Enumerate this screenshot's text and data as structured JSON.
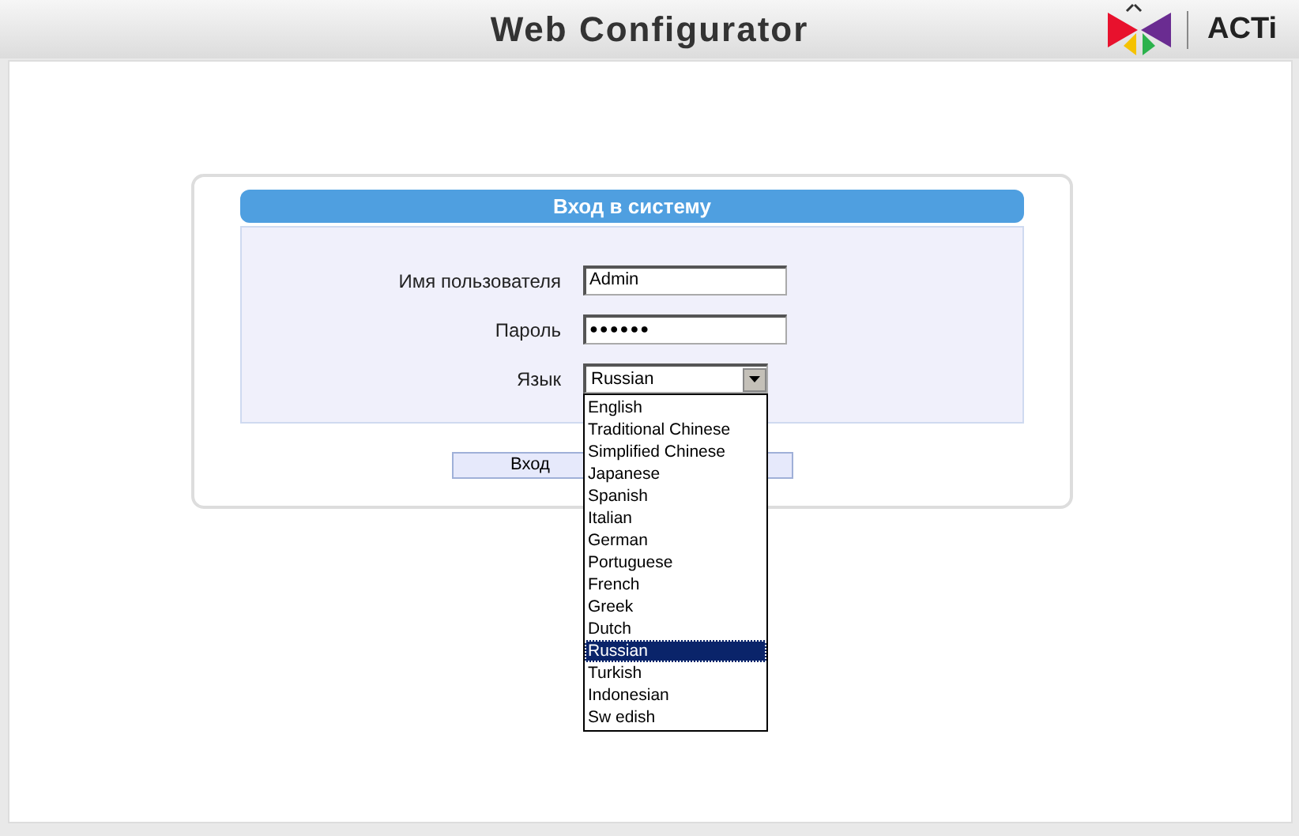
{
  "header": {
    "title": "Web Configurator",
    "logo_text": "ACTi"
  },
  "login": {
    "title": "Вход в систему",
    "fields": [
      {
        "kind": "text",
        "label": "Имя пользователя",
        "value": "Admin"
      },
      {
        "kind": "password",
        "label": "Пароль",
        "value": "●●●●●●"
      },
      {
        "kind": "select",
        "label": "Язык",
        "value": "Russian",
        "expanded": true
      }
    ],
    "button": "Вход"
  },
  "language_options": [
    {
      "label": "English",
      "selected": false
    },
    {
      "label": "Traditional Chinese",
      "selected": false
    },
    {
      "label": "Simplified Chinese",
      "selected": false
    },
    {
      "label": "Japanese",
      "selected": false
    },
    {
      "label": "Spanish",
      "selected": false
    },
    {
      "label": "Italian",
      "selected": false
    },
    {
      "label": "German",
      "selected": false
    },
    {
      "label": "Portuguese",
      "selected": false
    },
    {
      "label": "French",
      "selected": false
    },
    {
      "label": "Greek",
      "selected": false
    },
    {
      "label": "Dutch",
      "selected": false
    },
    {
      "label": "Russian",
      "selected": true
    },
    {
      "label": "Turkish",
      "selected": false
    },
    {
      "label": "Indonesian",
      "selected": false
    },
    {
      "label": "Sw edish",
      "selected": false
    }
  ]
}
